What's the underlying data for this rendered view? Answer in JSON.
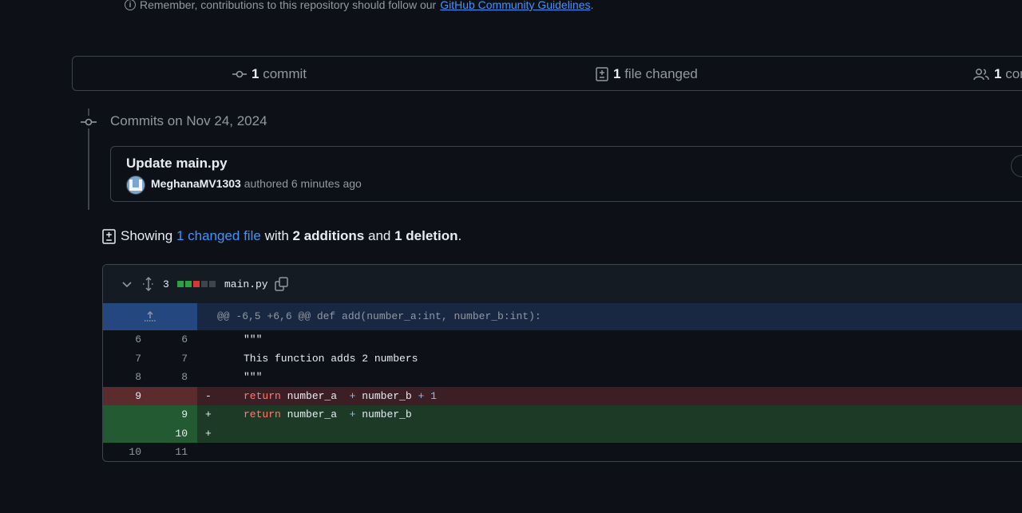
{
  "notice": {
    "prefix": "Remember, contributions to this repository should follow our",
    "link": "GitHub Community Guidelines",
    "suffix": "."
  },
  "tabs": {
    "commits": {
      "count": "1",
      "label": "commit"
    },
    "files": {
      "count": "1",
      "label": "file changed"
    },
    "contributors": {
      "count": "1",
      "label": "con"
    }
  },
  "timeline": {
    "date_label": "Commits on Nov 24, 2024",
    "commit": {
      "title": "Update main.py",
      "author": "MeghanaMV1303",
      "meta": "authored 6 minutes ago"
    }
  },
  "summary": {
    "showing": "Showing",
    "changed_link": "1 changed file",
    "with": "with",
    "additions": "2 additions",
    "and": "and",
    "deletions": "1 deletion",
    "end": "."
  },
  "file": {
    "change_count": "3",
    "name": "main.py",
    "hunk_header": "@@ -6,5 +6,6 @@ def add(number_a:int, number_b:int):",
    "lines": [
      {
        "old": "6",
        "new": "6",
        "sign": "",
        "code": "\"\"\""
      },
      {
        "old": "7",
        "new": "7",
        "sign": "",
        "code": "This function adds 2 numbers"
      },
      {
        "old": "8",
        "new": "8",
        "sign": "",
        "code": "\"\"\""
      },
      {
        "old": "9",
        "new": "",
        "sign": "-",
        "kw": "return",
        "a": " number_a  ",
        "op1": "+",
        "b": " number_b ",
        "op2": "+",
        "c": " 1"
      },
      {
        "old": "",
        "new": "9",
        "sign": "+",
        "kw": "return",
        "a": " number_a  ",
        "op1": "+",
        "b": " number_b"
      },
      {
        "old": "",
        "new": "10",
        "sign": "+",
        "code": ""
      },
      {
        "old": "10",
        "new": "11",
        "sign": "",
        "code": ""
      }
    ]
  },
  "colors": {
    "bg": "#0d1117",
    "border": "#3d444d",
    "accent": "#4493f8",
    "deletion_line_bg": "#3c1f24",
    "deletion_num_bg": "#5c2b2e",
    "addition_line_bg": "#1c3a26",
    "addition_num_bg": "#235a32",
    "hunk_bg": "#182842",
    "hunk_num_bg": "#24477f"
  }
}
